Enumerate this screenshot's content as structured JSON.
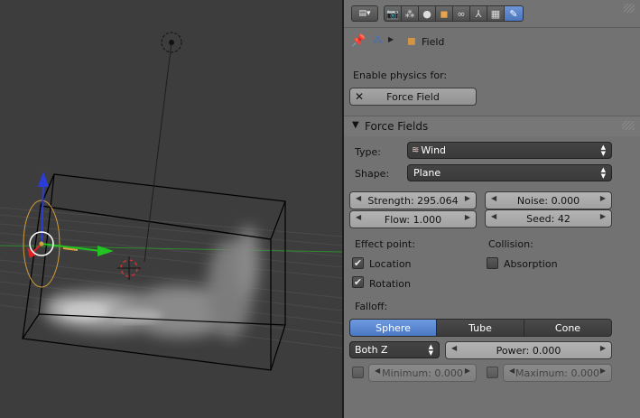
{
  "viewport": {
    "background": "#3d3d3d"
  },
  "header": {
    "editor_menu_icon": "editor-type-icon",
    "tabs": [
      {
        "icon": "render-icon"
      },
      {
        "icon": "render-layers-icon"
      },
      {
        "icon": "world-icon"
      },
      {
        "icon": "object-icon"
      },
      {
        "icon": "constraints-icon"
      },
      {
        "icon": "modifiers-icon"
      },
      {
        "icon": "texture-icon"
      },
      {
        "icon": "physics-icon",
        "active": true
      }
    ]
  },
  "breadcrumb": {
    "object_label": "Field"
  },
  "enable_physics": {
    "label": "Enable physics for:",
    "button": "Force Field"
  },
  "force_fields": {
    "title": "Force Fields",
    "type_label": "Type:",
    "type_value": "Wind",
    "shape_label": "Shape:",
    "shape_value": "Plane",
    "strength": "Strength: 295.064",
    "flow": "Flow: 1.000",
    "noise": "Noise: 0.000",
    "seed": "Seed: 42",
    "effect_point_label": "Effect point:",
    "location_label": "Location",
    "location_checked": true,
    "rotation_label": "Rotation",
    "rotation_checked": true,
    "collision_label": "Collision:",
    "absorption_label": "Absorption",
    "absorption_checked": false,
    "falloff_label": "Falloff:",
    "falloff_options": [
      "Sphere",
      "Tube",
      "Cone"
    ],
    "falloff_selected": "Sphere",
    "both_z": "Both Z",
    "power": "Power: 0.000",
    "minimum": "Minimum: 0.000",
    "maximum": "Maximum: 0.000"
  },
  "colors": {
    "accent": "#5680c2",
    "panel": "#727272",
    "dark_field": "#3f3f3f"
  }
}
